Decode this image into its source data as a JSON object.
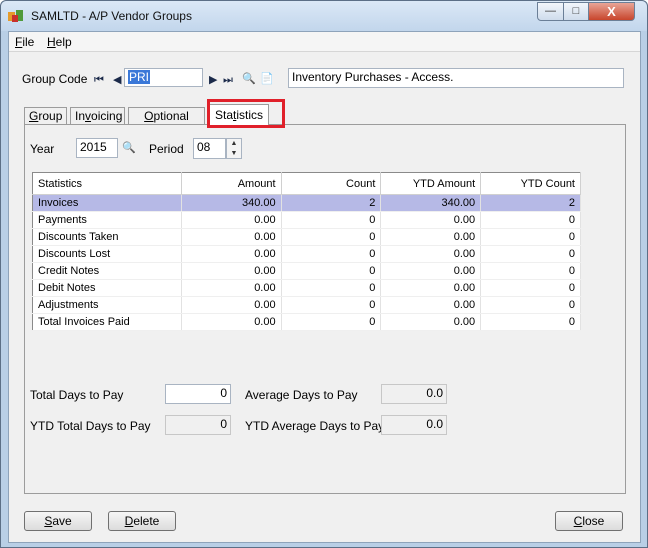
{
  "window": {
    "title": "SAMLTD - A/P Vendor Groups",
    "min_glyph": "—",
    "max_glyph": "□",
    "close_glyph": "X"
  },
  "menu": [
    {
      "label_u": "F",
      "label_rest": "ile"
    },
    {
      "label_u": "H",
      "label_rest": "elp"
    }
  ],
  "group_code": {
    "label": "Group Code",
    "value": "PRI",
    "description": "Inventory Purchases - Access."
  },
  "tabs": {
    "group": {
      "u": "G",
      "rest": "roup"
    },
    "invoicing": {
      "pre": "In",
      "u": "v",
      "rest": "oicing"
    },
    "optional_fields": {
      "u": "O",
      "rest": "ptional Fields"
    },
    "statistics": {
      "pre": "Sta",
      "u": "t",
      "rest": "istics"
    }
  },
  "filters": {
    "year_label": "Year",
    "year_value": "2015",
    "period_label": "Period",
    "period_value": "08"
  },
  "table": {
    "headers": [
      "Statistics",
      "Amount",
      "Count",
      "YTD Amount",
      "YTD Count"
    ],
    "rows": [
      [
        "Invoices",
        "340.00",
        "2",
        "340.00",
        "2"
      ],
      [
        "Payments",
        "0.00",
        "0",
        "0.00",
        "0"
      ],
      [
        "Discounts Taken",
        "0.00",
        "0",
        "0.00",
        "0"
      ],
      [
        "Discounts Lost",
        "0.00",
        "0",
        "0.00",
        "0"
      ],
      [
        "Credit Notes",
        "0.00",
        "0",
        "0.00",
        "0"
      ],
      [
        "Debit Notes",
        "0.00",
        "0",
        "0.00",
        "0"
      ],
      [
        "Adjustments",
        "0.00",
        "0",
        "0.00",
        "0"
      ],
      [
        "Total Invoices Paid",
        "0.00",
        "0",
        "0.00",
        "0"
      ]
    ],
    "selected_row_color": "#b6b9e6"
  },
  "days": {
    "total_label": "Total Days to Pay",
    "total_value": "0",
    "avg_label": "Average Days to Pay",
    "avg_value": "0.0",
    "ytd_total_label": "YTD Total Days to Pay",
    "ytd_total_value": "0",
    "ytd_avg_label": "YTD Average Days to Pay",
    "ytd_avg_value": "0.0"
  },
  "buttons": {
    "save": {
      "u": "S",
      "rest": "ave"
    },
    "delete": {
      "u": "D",
      "rest": "elete"
    },
    "close": {
      "u": "C",
      "rest": "lose"
    }
  },
  "icons": {
    "first": "⏮",
    "prev": "◀",
    "next": "▶",
    "last": "⏭",
    "search": "🔍",
    "new": "📄"
  },
  "colors": {
    "highlight_border": "#e0202a",
    "title_bar": "#c2d6ec"
  }
}
